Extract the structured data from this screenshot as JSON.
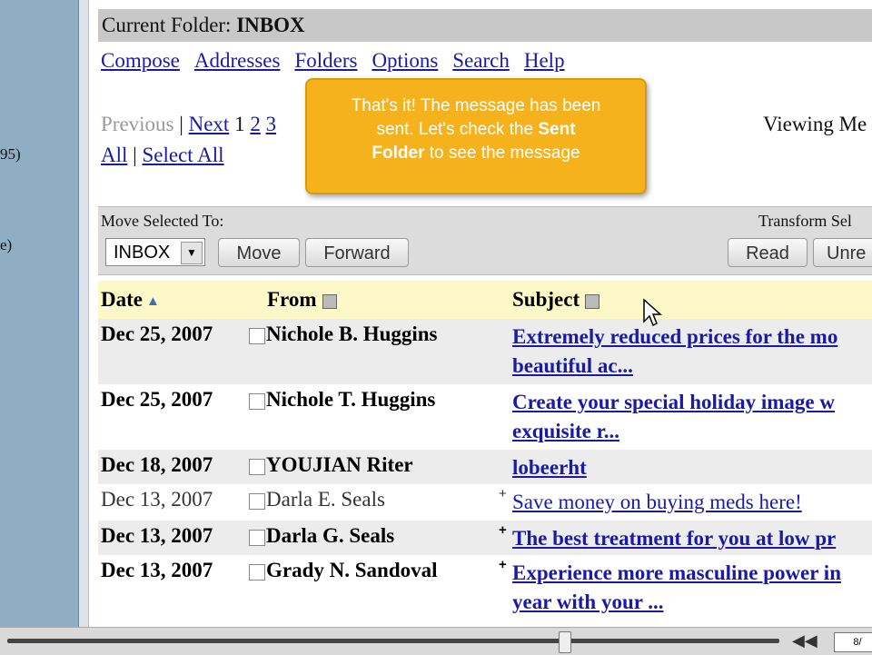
{
  "sidebar": {
    "fragment_1": "95)",
    "fragment_2": "e)"
  },
  "header": {
    "folder_label": "Current Folder:",
    "folder_name": "INBOX"
  },
  "nav": {
    "items": [
      "Compose",
      "Addresses",
      "Folders",
      "Options",
      "Search",
      "Help"
    ]
  },
  "pager": {
    "previous": "Previous",
    "separator": "|",
    "next": "Next",
    "pages": [
      "1",
      "2",
      "3"
    ],
    "all": "All",
    "select_all": "Select All",
    "viewing": "Viewing Me"
  },
  "tooltip": {
    "line1": "That's it!  The message has been",
    "line2_prefix": "sent. Let's check the",
    "line2_bold": "Sent",
    "line3_bold": "Folder",
    "line3_suffix": "to see the message"
  },
  "toolbar": {
    "move_label": "Move Selected To:",
    "transform_label": "Transform Sel",
    "folder_select": "INBOX",
    "move_button": "Move",
    "forward_button": "Forward",
    "read_button": "Read",
    "unread_button": "Unre"
  },
  "table": {
    "headers": {
      "date": "Date",
      "from": "From",
      "subject": "Subject"
    },
    "rows": [
      {
        "date": "Dec 25, 2007",
        "from": "Nichole B. Huggins",
        "flag": "",
        "subject": "Extremely reduced prices for the mo\nbeautiful ac..."
      },
      {
        "date": "Dec 25, 2007",
        "from": "Nichole T. Huggins",
        "flag": "",
        "subject": "Create your special holiday image w\nexquisite r..."
      },
      {
        "date": "Dec 18, 2007",
        "from": "YOUJIAN Riter",
        "flag": "",
        "subject": "lobeerht"
      },
      {
        "date": "Dec 13, 2007",
        "from": "Darla E. Seals",
        "flag": "+",
        "subject": "Save money on buying meds here!"
      },
      {
        "date": "Dec 13, 2007",
        "from": "Darla G. Seals",
        "flag": "+",
        "subject": "The best treatment for you at low pr"
      },
      {
        "date": "Dec 13, 2007",
        "from": "Grady N. Sandoval",
        "flag": "+",
        "subject": "Experience more masculine power in\nyear with your ..."
      }
    ]
  },
  "player": {
    "time_display": "8/"
  }
}
